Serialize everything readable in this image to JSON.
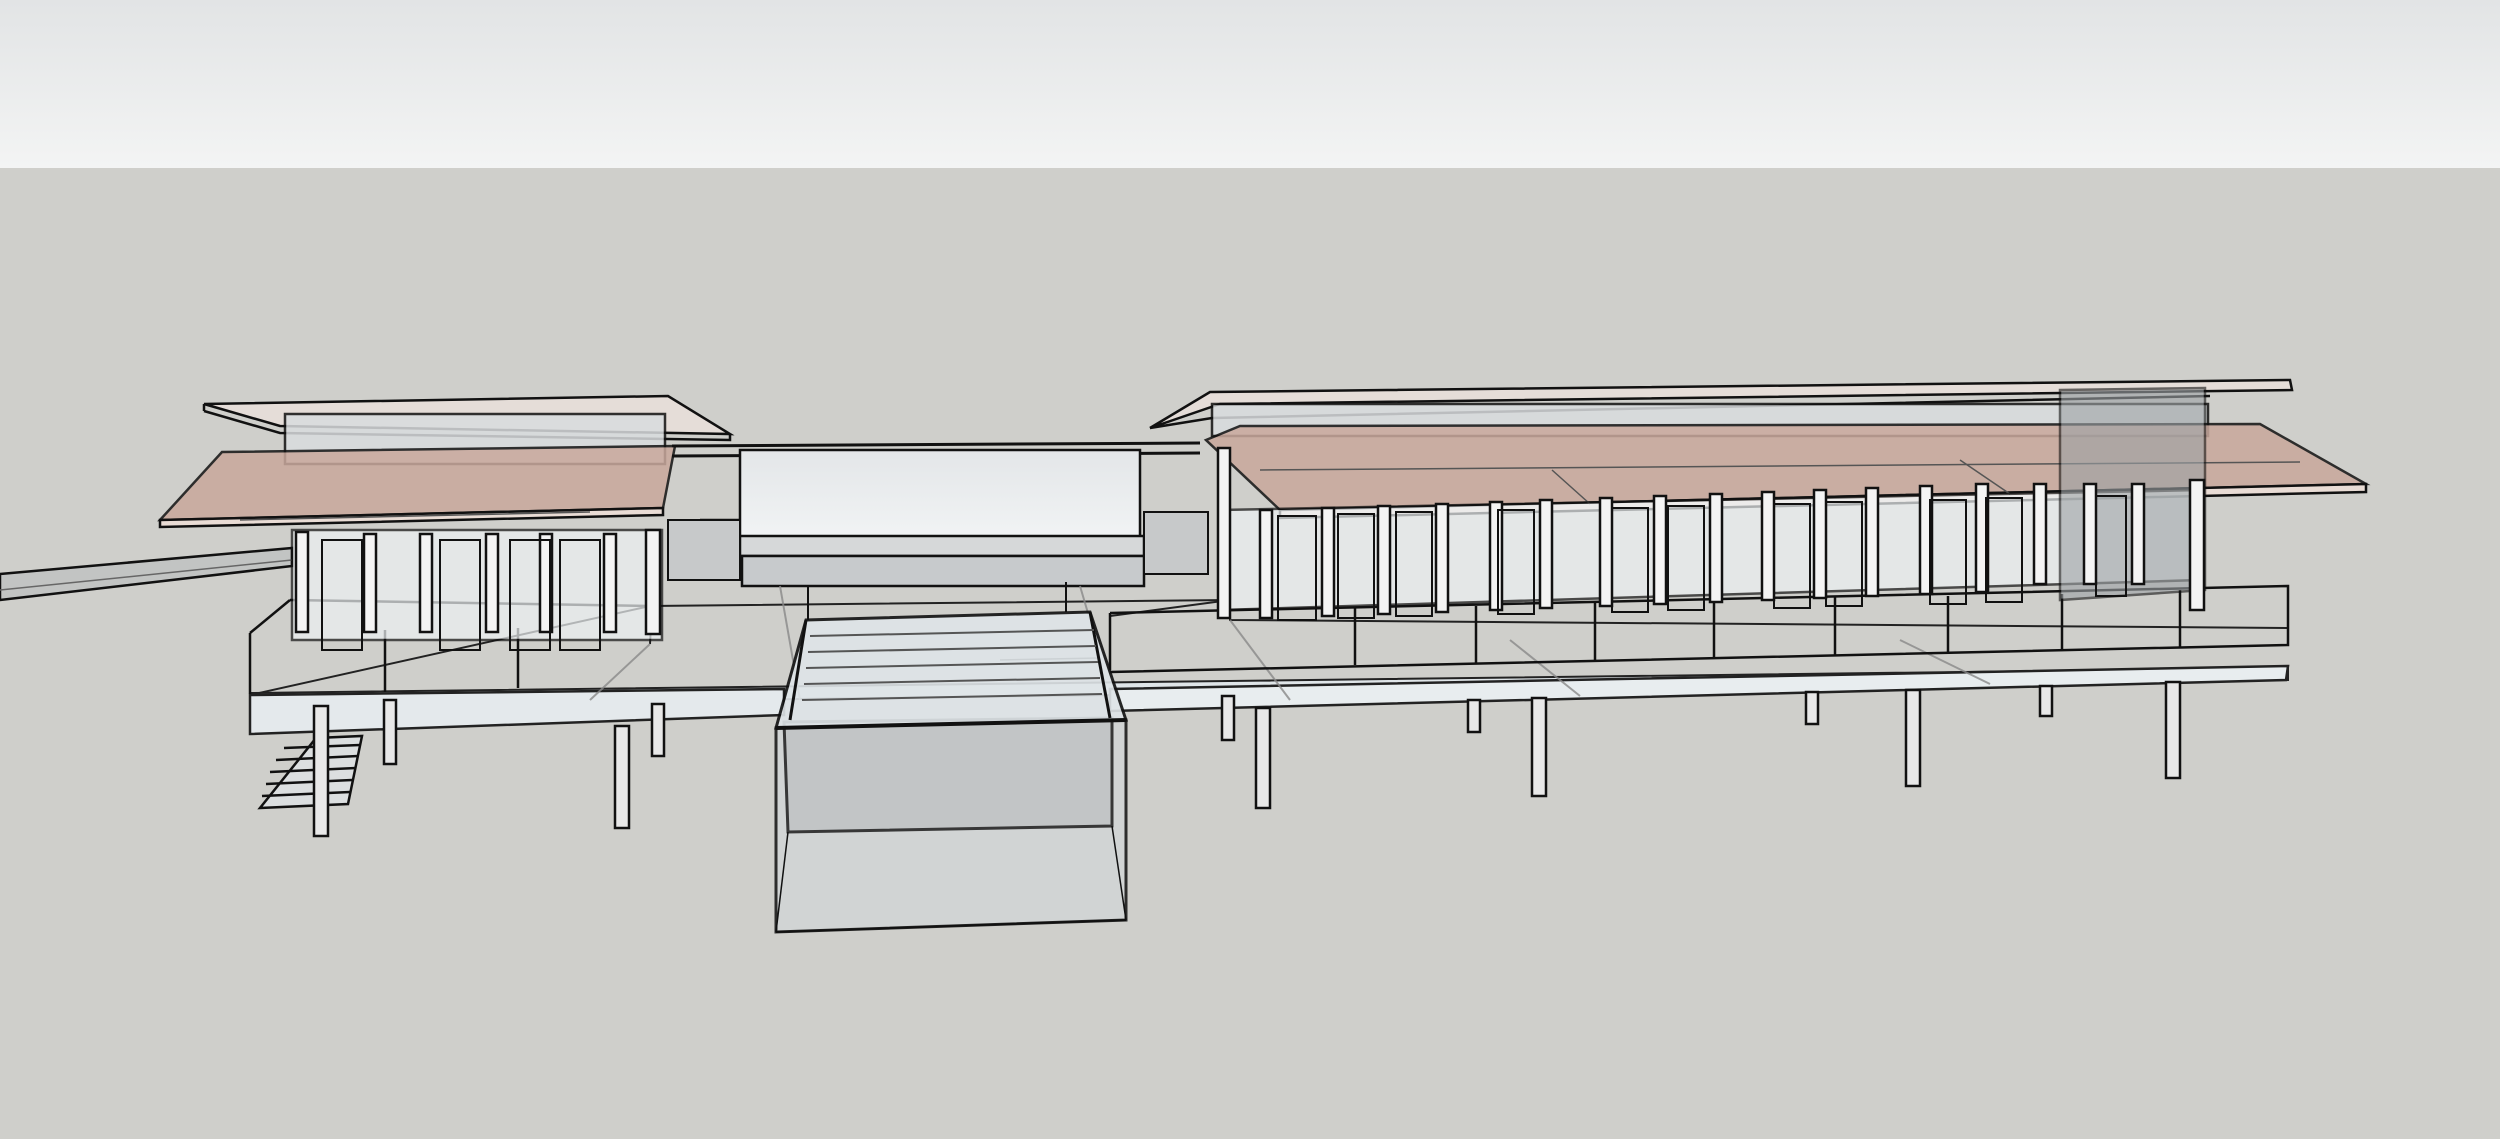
{
  "viewport": {
    "sky_color_top": "#e2e4e5",
    "sky_color_bottom": "#f3f4f4",
    "ground_color": "#cfcfcb",
    "edge_color": "#111111",
    "roof_tint_color": "#c9a89c",
    "roof_panel_color": "#e5ddd8",
    "glass_color": "#eef2f4"
  },
  "model": {
    "buildings": [
      "left-pavilion",
      "right-pavilion"
    ],
    "features": [
      "connecting-walkway",
      "center-wall",
      "pool",
      "deck",
      "stairs",
      "columns",
      "ramp"
    ]
  }
}
